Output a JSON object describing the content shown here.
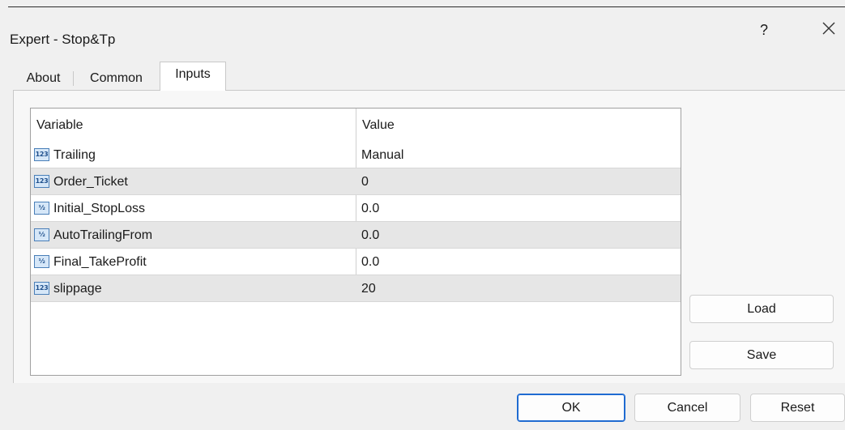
{
  "window": {
    "title": "Expert - Stop&Tp",
    "help_label": "?"
  },
  "tabs": [
    {
      "label": "About"
    },
    {
      "label": "Common"
    },
    {
      "label": "Inputs"
    }
  ],
  "grid": {
    "headers": {
      "variable": "Variable",
      "value": "Value"
    },
    "rows": [
      {
        "icon": "int-icon",
        "icon_text": "123",
        "name": "Trailing",
        "value": "Manual"
      },
      {
        "icon": "int-icon",
        "icon_text": "123",
        "name": "Order_Ticket",
        "value": "0"
      },
      {
        "icon": "double-icon",
        "icon_text": "½",
        "name": "Initial_StopLoss",
        "value": "0.0"
      },
      {
        "icon": "double-icon",
        "icon_text": "½",
        "name": "AutoTrailingFrom",
        "value": "0.0"
      },
      {
        "icon": "double-icon",
        "icon_text": "½",
        "name": "Final_TakeProfit",
        "value": "0.0"
      },
      {
        "icon": "int-icon",
        "icon_text": "123",
        "name": "slippage",
        "value": "20"
      }
    ]
  },
  "buttons": {
    "load": "Load",
    "save": "Save",
    "ok": "OK",
    "cancel": "Cancel",
    "reset": "Reset"
  },
  "colors": {
    "accent": "#1f6bd1",
    "icon_fill": "#d6e7f8"
  }
}
